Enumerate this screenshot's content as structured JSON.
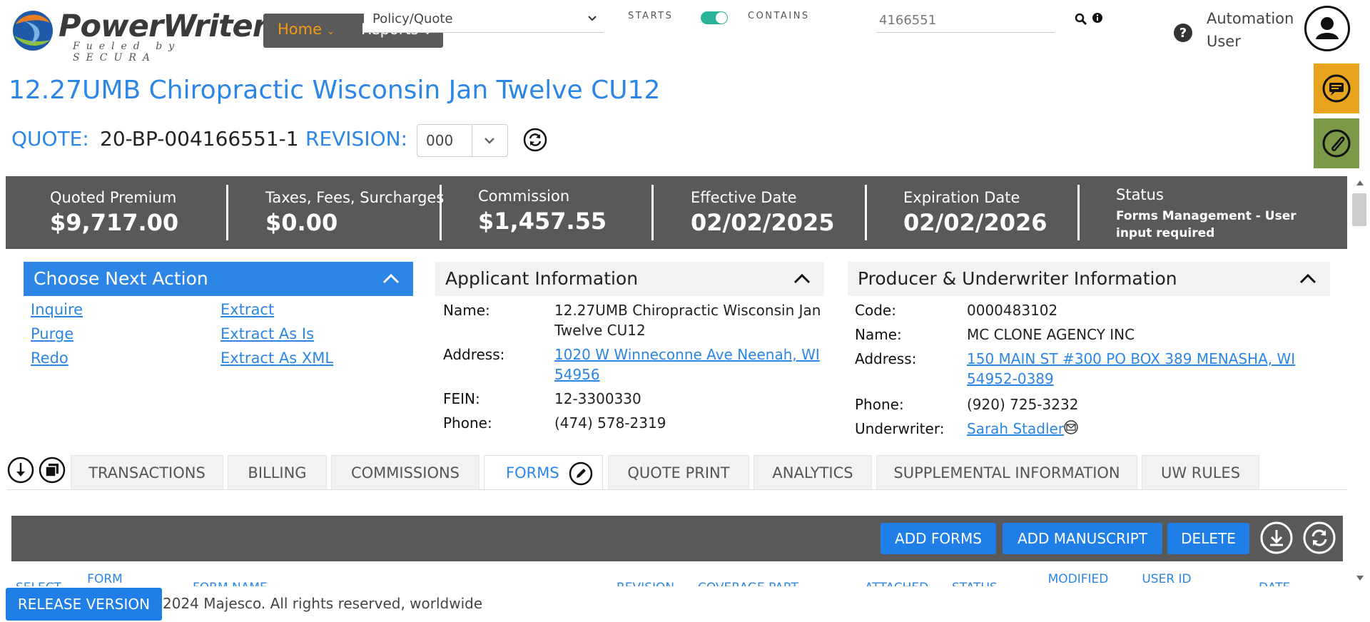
{
  "header": {
    "logo_text": "PowerWriter",
    "logo_sub": "Fueled by SECURA",
    "nav": {
      "home": "Home",
      "reports": "Reports"
    },
    "search_type": "Policy/Quote",
    "starts_label": "STARTS",
    "contains_label": "CONTAINS",
    "search_value": "4166551",
    "user_name": "Automation User"
  },
  "page": {
    "title": "12.27UMB Chiropractic Wisconsin Jan Twelve CU12",
    "quote_label": "QUOTE:",
    "quote_number": "20-BP-004166551-1",
    "revision_label": "REVISION:",
    "revision_value": "000"
  },
  "summary": {
    "quoted_premium_label": "Quoted Premium",
    "quoted_premium": "$9,717.00",
    "taxes_label": "Taxes, Fees, Surcharges",
    "taxes": "$0.00",
    "commission_label": "Commission",
    "commission": "$1,457.55",
    "effective_label": "Effective Date",
    "effective": "02/02/2025",
    "expiration_label": "Expiration Date",
    "expiration": "02/02/2026",
    "status_label": "Status",
    "status": "Forms Management - User input required"
  },
  "actions": {
    "title": "Choose Next Action",
    "items": [
      "Inquire",
      "Purge",
      "Redo",
      "Extract",
      "Extract As Is",
      "Extract As XML"
    ]
  },
  "applicant": {
    "title": "Applicant Information",
    "name_label": "Name:",
    "name": "12.27UMB Chiropractic Wisconsin Jan Twelve CU12",
    "address_label": "Address:",
    "address": "1020 W Winneconne Ave Neenah, WI 54956",
    "fein_label": "FEIN:",
    "fein": "12-3300330",
    "phone_label": "Phone:",
    "phone": "(474) 578-2319"
  },
  "producer": {
    "title": "Producer & Underwriter Information",
    "code_label": "Code:",
    "code": "0000483102",
    "name_label": "Name:",
    "name": "MC CLONE AGENCY INC",
    "address_label": "Address:",
    "address": "150 MAIN ST #300 PO BOX 389 MENASHA, WI 54952-0389",
    "phone_label": "Phone:",
    "phone": "(920) 725-3232",
    "underwriter_label": "Underwriter:",
    "underwriter": "Sarah Stadler"
  },
  "tabs": [
    "TRANSACTIONS",
    "BILLING",
    "COMMISSIONS",
    "FORMS",
    "QUOTE PRINT",
    "ANALYTICS",
    "SUPPLEMENTAL INFORMATION",
    "UW RULES"
  ],
  "forms": {
    "add_forms": "ADD FORMS",
    "add_manuscript": "ADD MANUSCRIPT",
    "delete": "DELETE",
    "columns": [
      "SELECT",
      "FORM NUMBER",
      "FORM NAME",
      "REVISION",
      "COVERAGE PART",
      "ATTACHED",
      "STATUS",
      "MODIFIED BY",
      "USER ID",
      "DATE"
    ]
  },
  "footer": {
    "release": "RELEASE VERSION",
    "copyright": "2024 Majesco. All rights reserved, worldwide"
  },
  "colors": {
    "brand_blue": "#2b86e6",
    "bar_gray": "#595959",
    "nav_orange": "#f39c12",
    "toggle_green": "#2bb39a",
    "chat_amber": "#e8a31c",
    "attach_green": "#7a9a47"
  }
}
